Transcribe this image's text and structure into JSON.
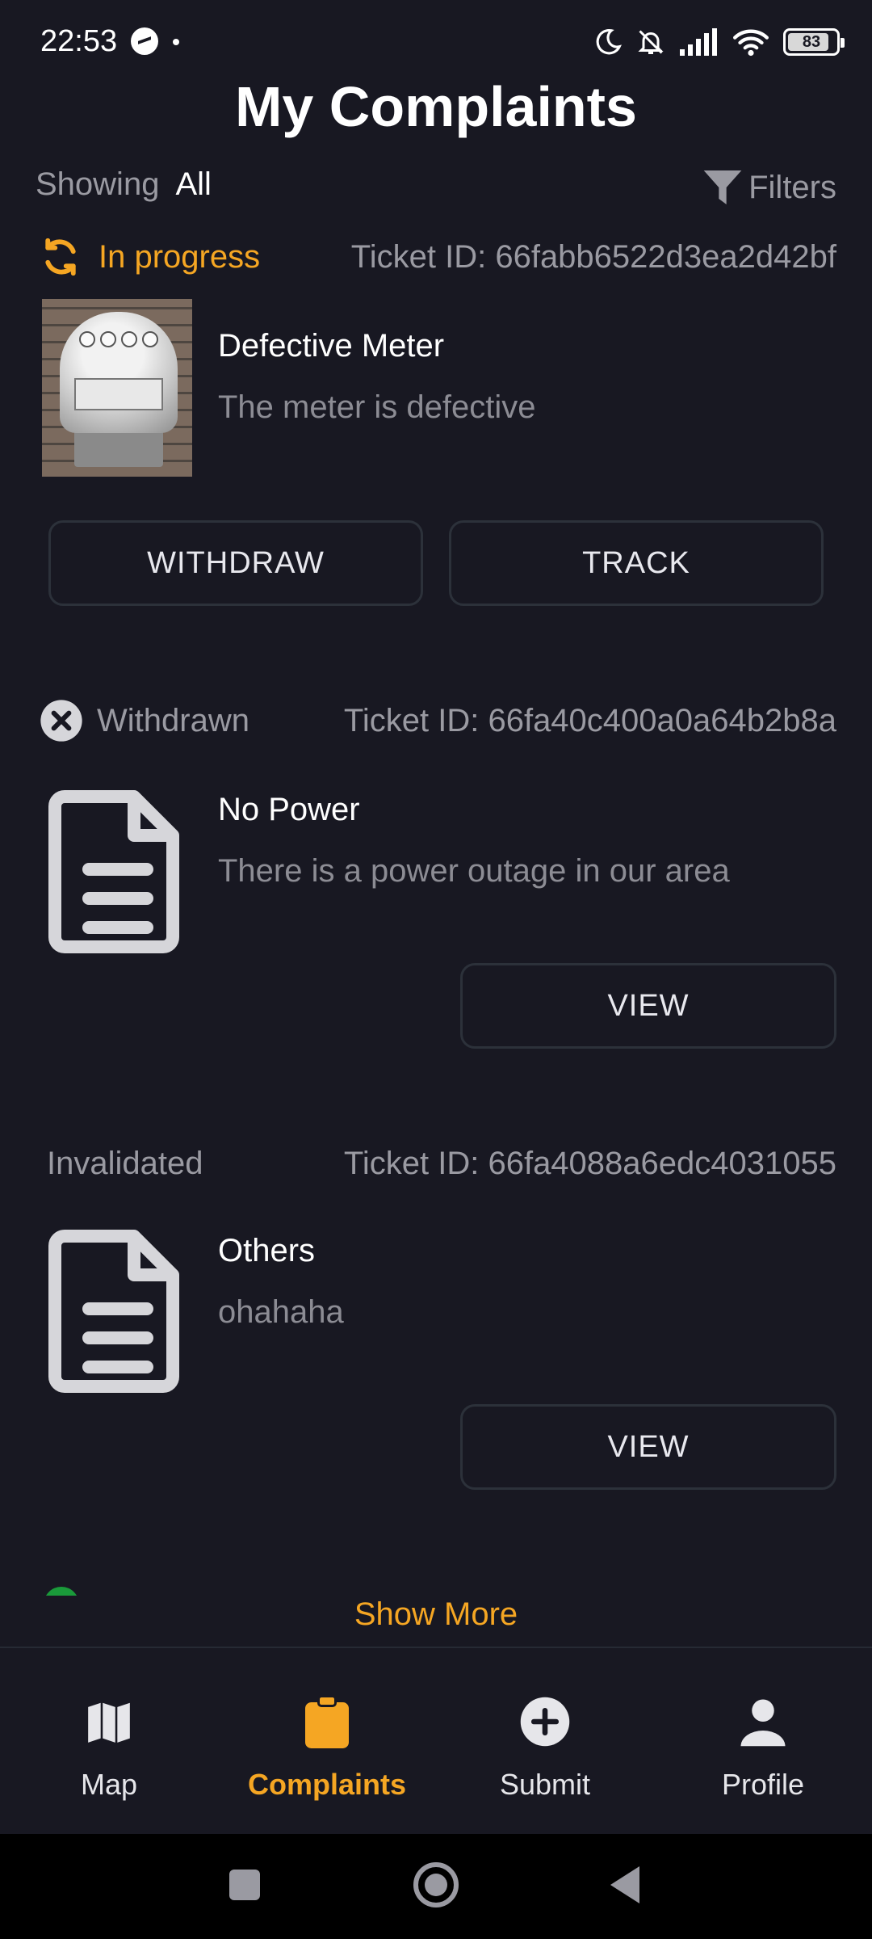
{
  "status_bar": {
    "time": "22:53",
    "battery": "83"
  },
  "header": {
    "title": "My Complaints"
  },
  "filter_bar": {
    "showing_label": "Showing",
    "showing_value": "All",
    "filters_label": "Filters"
  },
  "complaints": [
    {
      "status": "In progress",
      "status_color": "#f5a623",
      "ticket": "Ticket ID: 66fabb6522d3ea2d42bf",
      "title": "Defective Meter",
      "description": "The meter is defective",
      "thumbnail": "electric-meter-photo",
      "buttons": [
        "WITHDRAW",
        "TRACK"
      ]
    },
    {
      "status": "Withdrawn",
      "status_color": "#9a9aa2",
      "ticket": "Ticket ID: 66fa40c400a0a64b2b8a",
      "title": "No Power",
      "description": "There is a power outage in our area",
      "thumbnail": "document-icon",
      "buttons": [
        "VIEW"
      ]
    },
    {
      "status": "Invalidated",
      "status_color": "#9a9aa2",
      "ticket": "Ticket ID: 66fa4088a6edc4031055",
      "title": "Others",
      "description": "ohahaha",
      "thumbnail": "document-icon",
      "buttons": [
        "VIEW"
      ]
    }
  ],
  "show_more": "Show More",
  "bottom_nav": {
    "items": [
      {
        "label": "Map",
        "icon": "map-icon"
      },
      {
        "label": "Complaints",
        "icon": "clipboard-icon",
        "active": true
      },
      {
        "label": "Submit",
        "icon": "add-circle-icon"
      },
      {
        "label": "Profile",
        "icon": "person-icon"
      }
    ]
  },
  "colors": {
    "background": "#181822",
    "accent": "#f5a623",
    "muted": "#9a9aa2",
    "button_border": "#2c313a"
  }
}
